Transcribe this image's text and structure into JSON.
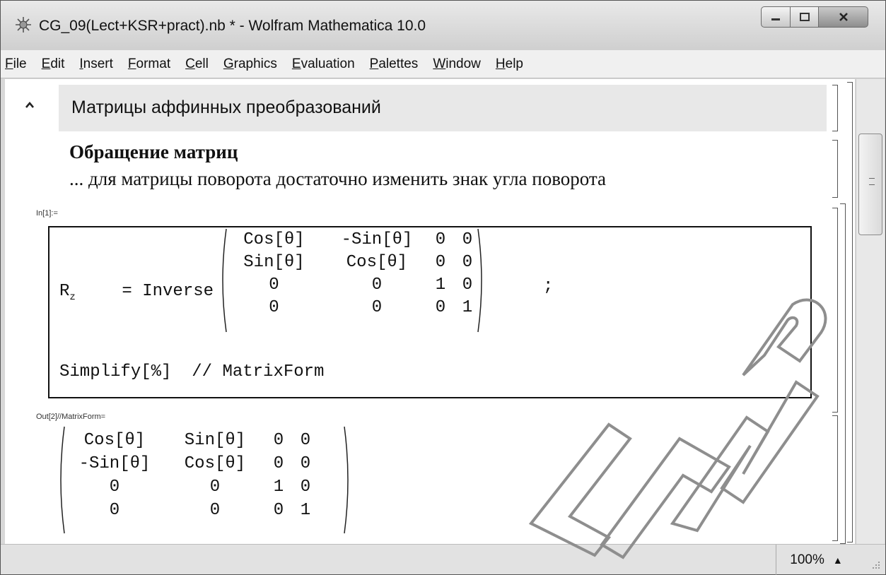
{
  "window": {
    "title": "CG_09(Lect+KSR+pract).nb * - Wolfram Mathematica 10.0",
    "icon": "mathematica-spikey-icon"
  },
  "menu": [
    "File",
    "Edit",
    "Insert",
    "Format",
    "Cell",
    "Graphics",
    "Evaluation",
    "Palettes",
    "Window",
    "Help"
  ],
  "notebook": {
    "section_title": "Матрицы аффинных преобразований",
    "subsection_title": "Обращение матриц",
    "text": "... для матрицы поворота достаточно изменить знак угла поворота",
    "input_label": "In[1]:=",
    "output_label": "Out[2]//MatrixForm=",
    "input": {
      "lhs": "R",
      "lhs_subscript": "z",
      "assign": " = Inverse",
      "terminator": ";",
      "line2": "Simplify[%]  // MatrixForm",
      "matrix": [
        [
          "Cos[θ]",
          "-Sin[θ]",
          "0",
          "0"
        ],
        [
          "Sin[θ]",
          "Cos[θ]",
          "0",
          "0"
        ],
        [
          "0",
          "0",
          "1",
          "0"
        ],
        [
          "0",
          "0",
          "0",
          "1"
        ]
      ]
    },
    "output_matrix": [
      [
        "Cos[θ]",
        "Sin[θ]",
        "0",
        "0"
      ],
      [
        "-Sin[θ]",
        "Cos[θ]",
        "0",
        "0"
      ],
      [
        "0",
        "0",
        "1",
        "0"
      ],
      [
        "0",
        "0",
        "0",
        "1"
      ]
    ]
  },
  "status": {
    "zoom": "100%"
  },
  "watermark": "БГУИР",
  "colors": {
    "selection_bg": "#e8e8e8",
    "frame": "#555555"
  }
}
